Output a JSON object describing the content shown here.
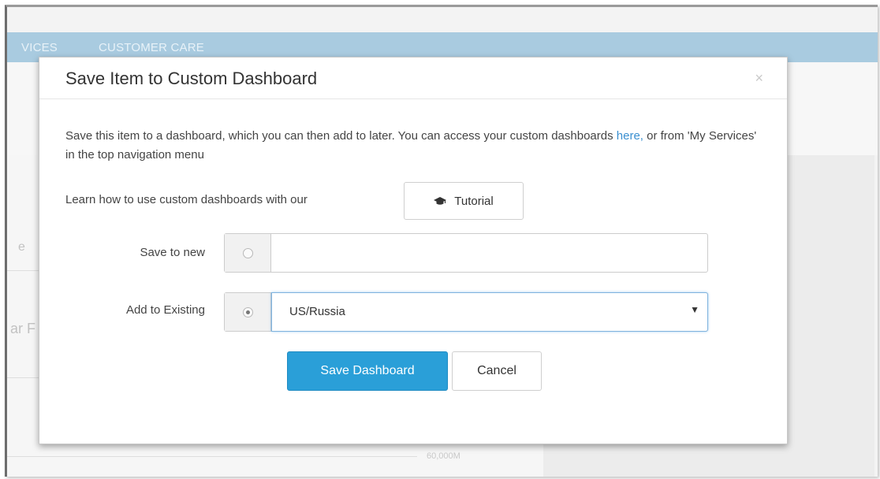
{
  "background": {
    "nav_items": [
      "VICES",
      "CUSTOMER CARE"
    ],
    "side_text": [
      "e",
      "ar F",
      ","
    ],
    "axis_tick": "60,000M"
  },
  "modal": {
    "title": "Save Item to Custom Dashboard",
    "close_label": "×",
    "description_before_link": "Save this item to a dashboard, which you can then add to later. You can access your custom dashboards ",
    "link_text": "here,",
    "description_after_link": " or from 'My Services' in the top navigation menu",
    "learn_text": "Learn how to use custom dashboards with our",
    "tutorial_button": {
      "label": "Tutorial",
      "icon": "graduation-cap-icon"
    },
    "save_to_new": {
      "label": "Save to new",
      "value": "",
      "selected": false
    },
    "add_to_existing": {
      "label": "Add to Existing",
      "selected_value": "US/Russia",
      "selected": true
    },
    "save_button": "Save Dashboard",
    "cancel_button": "Cancel"
  },
  "colors": {
    "nav_bar": "#a9cbe0",
    "primary": "#2a9fd8",
    "link": "#3a8fd0"
  }
}
